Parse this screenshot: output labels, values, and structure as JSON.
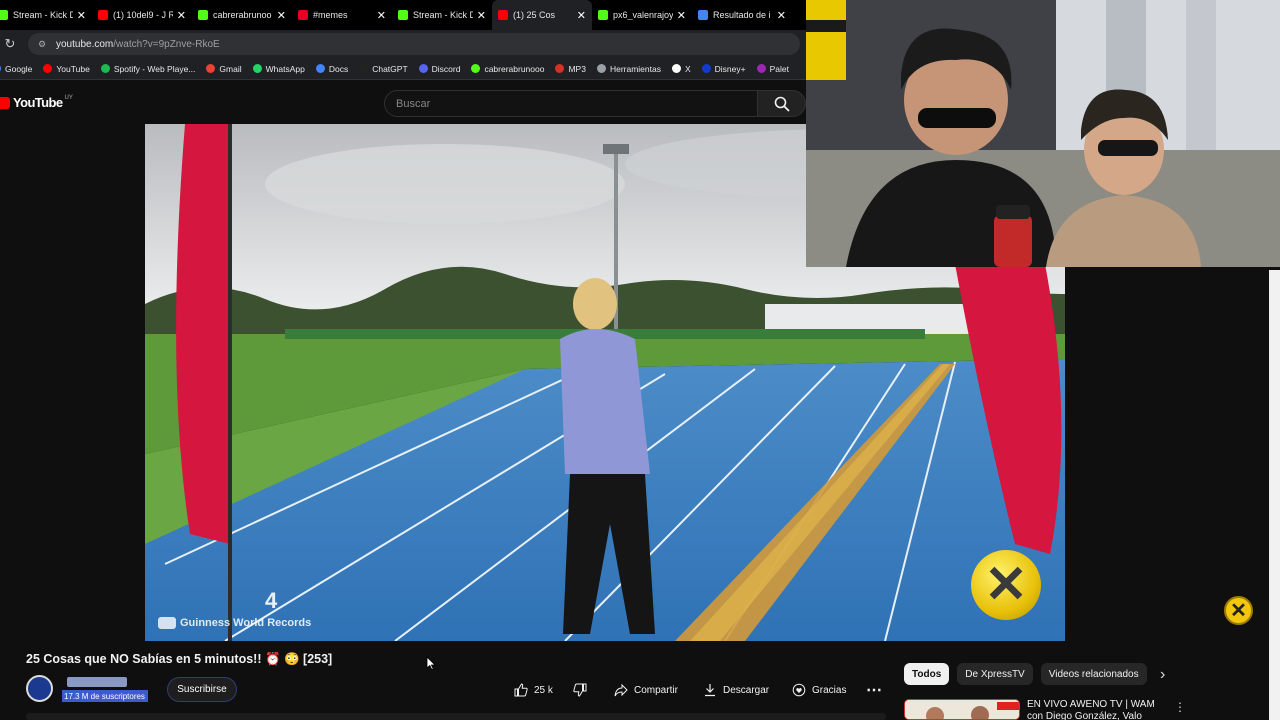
{
  "browser": {
    "tabs": [
      {
        "title": "Stream - Kick D",
        "favicon_color": "#53fc18",
        "active": false
      },
      {
        "title": "(1) 10del9 - J R",
        "favicon_color": "#ff0000",
        "active": false
      },
      {
        "title": "cabrerabrunoo",
        "favicon_color": "#53fc18",
        "active": false
      },
      {
        "title": "#memes",
        "favicon_color": "#e60023",
        "active": false
      },
      {
        "title": "Stream - Kick D",
        "favicon_color": "#53fc18",
        "active": false
      },
      {
        "title": "(1) 25 Cos",
        "favicon_color": "#ff0000",
        "active": true
      },
      {
        "title": "px6_valenrajoy",
        "favicon_color": "#53fc18",
        "active": false
      },
      {
        "title": "Resultado de i",
        "favicon_color": "#4285f4",
        "active": false
      }
    ],
    "url_host": "youtube.com",
    "url_path": "/watch?v=9pZnve-RkoE",
    "bookmarks": [
      {
        "label": "Google",
        "color": "#4285f4"
      },
      {
        "label": "YouTube",
        "color": "#ff0000"
      },
      {
        "label": "Spotify - Web Playe...",
        "color": "#1db954"
      },
      {
        "label": "Gmail",
        "color": "#ea4335"
      },
      {
        "label": "WhatsApp",
        "color": "#25d366"
      },
      {
        "label": "Docs",
        "color": "#4285f4"
      },
      {
        "label": "ChatGPT",
        "color": "#222222"
      },
      {
        "label": "Discord",
        "color": "#5865f2"
      },
      {
        "label": "cabrerabrunooo",
        "color": "#53fc18"
      },
      {
        "label": "MP3",
        "color": "#d93025"
      },
      {
        "label": "Herramientas",
        "color": "#9aa0a6"
      },
      {
        "label": "X",
        "color": "#ffffff"
      },
      {
        "label": "Disney+",
        "color": "#113ccf"
      },
      {
        "label": "Palet",
        "color": "#9c27b0"
      }
    ]
  },
  "youtube": {
    "logo_text": "YouTube",
    "region": "UY",
    "search_placeholder": "Buscar",
    "video_watermark": "Guinness World Records",
    "video_title": "25 Cosas que NO Sabías en 5 minutos!! ⏰ 😳 [253]",
    "subscribers": "17.3 M de suscriptores",
    "subscribe_label": "Suscribirse",
    "likes": "25 k",
    "share_label": "Compartir",
    "download_label": "Descargar",
    "thanks_label": "Gracias",
    "chips": [
      "Todos",
      "De XpressTV",
      "Videos relacionados"
    ],
    "recommended": {
      "title": "EN VIVO AWENO TV | WAM con Diego González, Valo Alvariza"
    }
  },
  "colors": {
    "accent_red": "#ff0000",
    "track_blue": "#3b7fbf",
    "banner_red": "#d5163f",
    "overlay_yellow": "#f2c60c"
  }
}
